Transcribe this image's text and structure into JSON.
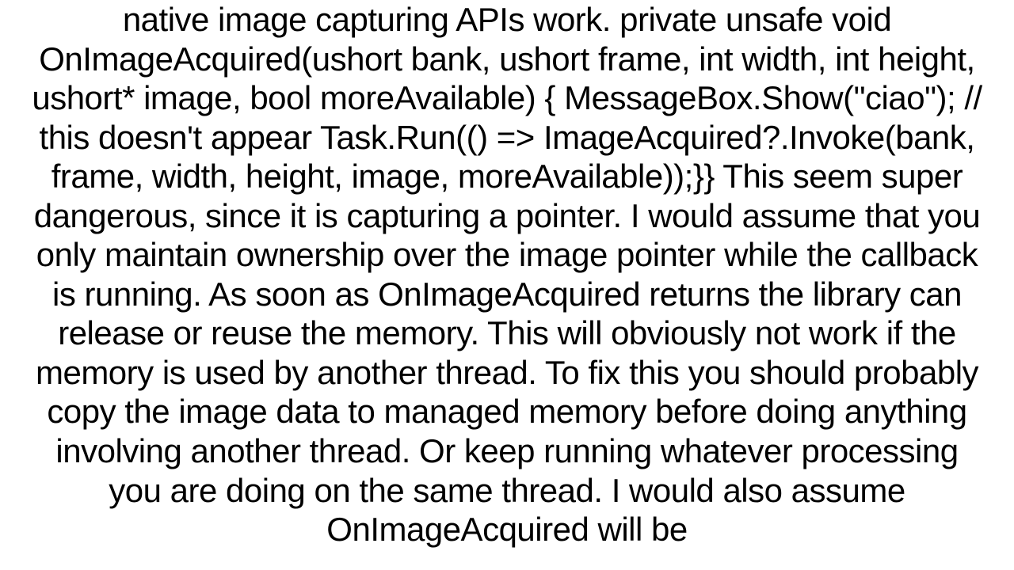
{
  "document": {
    "body_text": "native image capturing APIs work. private unsafe void OnImageAcquired(ushort bank, ushort frame, int width, int height, ushort* image, bool moreAvailable)          {            MessageBox.Show(\"ciao\"); // this doesn't appear            Task.Run(() => ImageAcquired?.Invoke(bank, frame, width, height, image, moreAvailable));}}  This seem super dangerous, since it is capturing a pointer. I would assume that you only maintain ownership over the image pointer while the callback is running. As soon as OnImageAcquired returns the library can release or reuse the memory. This will obviously not work if the memory is used by another thread. To fix this you should probably copy the image data to managed memory before doing anything involving another thread. Or keep running whatever processing you are doing on the same thread. I would also assume OnImageAcquired will be"
  }
}
